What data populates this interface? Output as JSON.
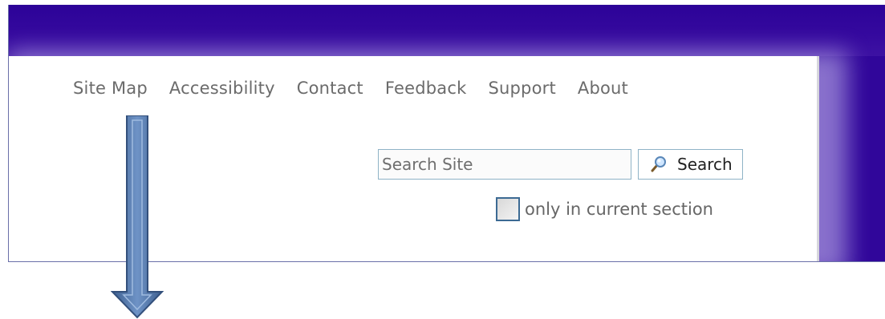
{
  "nav": {
    "items": [
      {
        "label": "Site Map"
      },
      {
        "label": "Accessibility"
      },
      {
        "label": "Contact"
      },
      {
        "label": "Feedback"
      },
      {
        "label": "Support"
      },
      {
        "label": "About"
      }
    ]
  },
  "search": {
    "placeholder": "Search Site",
    "value": "",
    "button_label": "Search",
    "icon": "magnifier-icon"
  },
  "option": {
    "label": "only in current section",
    "checked": false
  },
  "annotation": {
    "icon": "arrow-down-icon",
    "color": "#4a6fa5"
  },
  "colors": {
    "header_background": "#30069a",
    "nav_text": "#6b6b6b",
    "input_border": "#8fb3c7",
    "checkbox_border": "#3c6a93"
  }
}
